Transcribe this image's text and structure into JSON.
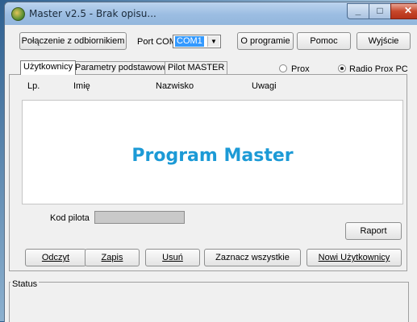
{
  "window": {
    "title": "Master v2.5 - Brak opisu..."
  },
  "toolbar": {
    "connect_label": "Połączenie z odbiornikiem",
    "port_label": "Port COM:",
    "port_value": "COM1",
    "about_label": "O programie",
    "help_label": "Pomoc",
    "exit_label": "Wyjście"
  },
  "tabs": [
    {
      "label": "Użytkownicy",
      "active": true
    },
    {
      "label": "Parametry podstawowe",
      "active": false
    },
    {
      "label": "Pilot MASTER",
      "active": false
    }
  ],
  "radios": [
    {
      "label": "Prox",
      "checked": false
    },
    {
      "label": "Radio Prox PC",
      "checked": true
    }
  ],
  "table": {
    "columns": [
      "Lp.",
      "Imię",
      "Nazwisko",
      "Uwagi"
    ]
  },
  "banner": {
    "text": "Program Master",
    "color": "#1c9ad6"
  },
  "pilot": {
    "label": "Kod pilota",
    "value": ""
  },
  "buttons": {
    "report": "Raport",
    "read": "Odczyt",
    "save": "Zapis",
    "delete": "Usuń",
    "select_all": "Zaznacz wszystkie",
    "new_users": "Nowi Użytkownicy"
  },
  "status": {
    "label": "Status"
  }
}
